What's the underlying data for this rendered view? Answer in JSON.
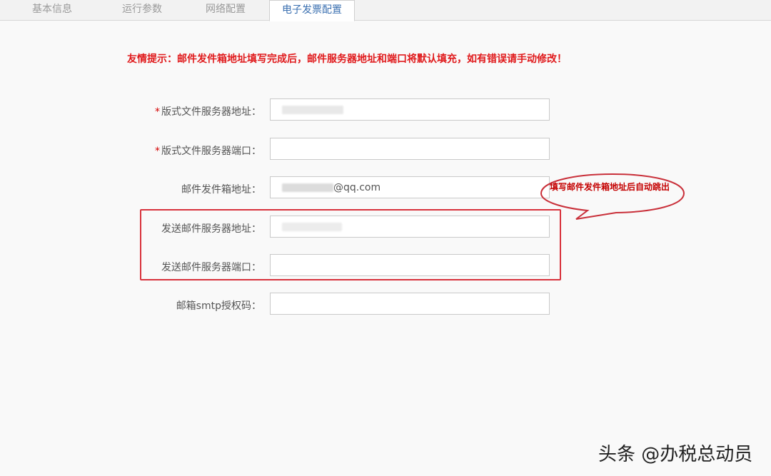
{
  "tabs": [
    {
      "label": "基本信息"
    },
    {
      "label": "运行参数"
    },
    {
      "label": "网络配置"
    },
    {
      "label": "电子发票配置"
    }
  ],
  "notice": "友情提示：邮件发件箱地址填写完成后，邮件服务器地址和端口将默认填充，如有错误请手动修改！",
  "form": {
    "required_mark": "*",
    "format_server_address_label": "版式文件服务器地址：",
    "format_server_port_label": "版式文件服务器端口：",
    "sender_email_label": "邮件发件箱地址：",
    "sender_email_value": "@qq.com",
    "smtp_server_address_label": "发送邮件服务器地址：",
    "smtp_server_port_label": "发送邮件服务器端口：",
    "smtp_auth_code_label": "邮箱smtp授权码："
  },
  "callout": {
    "text": "填写邮件发件箱地址后自动跳出"
  },
  "watermark": "头条 @办税总动员",
  "colors": {
    "notice": "#e0191b",
    "highlight": "#d8323c",
    "active_tab": "#3a6fb0"
  }
}
